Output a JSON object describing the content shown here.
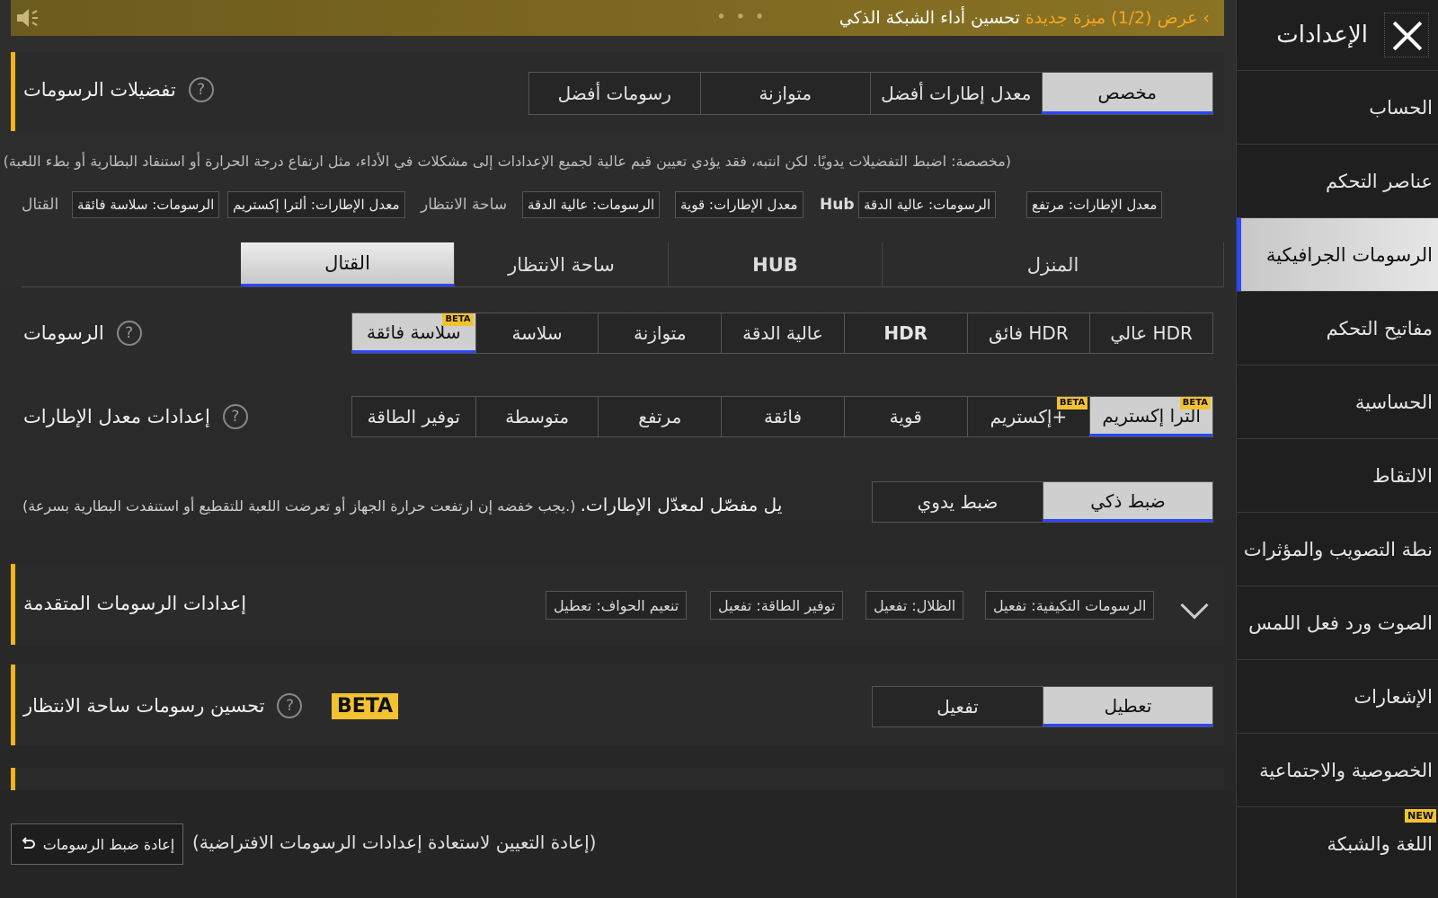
{
  "topbar": {
    "offer": "عرض (1/2)",
    "feature": "ميزة جديدة",
    "message": "تحسين أداء الشبكة الذكي"
  },
  "sidebar": {
    "title": "الإعدادات",
    "items": [
      {
        "label": "الحساب"
      },
      {
        "label": "عناصر التحكم"
      },
      {
        "label": "الرسومات الجرافيكية"
      },
      {
        "label": "مفاتيح التحكم"
      },
      {
        "label": "الحساسية"
      },
      {
        "label": "الالتقاط"
      },
      {
        "label": "نطة التصويب والمؤثرات"
      },
      {
        "label": "الصوت ورد فعل اللمس"
      },
      {
        "label": "الإشعارات"
      },
      {
        "label": "الخصوصية والاجتماعية"
      },
      {
        "label": "اللغة والشبكة",
        "badge": "NEW"
      }
    ]
  },
  "preferences": {
    "label": "تفضيلات الرسومات",
    "options": [
      "مخصص",
      "معدل إطارات أفضل",
      "متوازنة",
      "رسومات أفضل"
    ],
    "note": "(مخصصة: اضبط التفضيلات يدويًا. لكن انتبه، فقد يؤدي تعيين قيم عالية لجميع الإعدادات إلى مشكلات في الأداء، مثل ارتفاع درجة الحرارة أو استنفاد البطارية أو بطء اللعبة)",
    "summary": {
      "home_fps": "معدل الإطارات: مرتفع",
      "home_gfx": "الرسومات: عالية الدقة",
      "hub_label": "Hub",
      "hub_fps": "معدل الإطارات: قوية",
      "hub_gfx": "الرسومات: عالية الدقة",
      "lobby_label": "ساحة الانتظار",
      "combat_fps": "معدل الإطارات: ألترا إكستريم",
      "combat_gfx": "الرسومات: سلاسة فائقة",
      "combat_label": "القتال"
    }
  },
  "tabs": [
    "المنزل",
    "HUB",
    "ساحة الانتظار",
    "القتال"
  ],
  "graphics": {
    "label": "الرسومات",
    "options": [
      "عالي HDR",
      "فائق HDR",
      "HDR",
      "عالية الدقة",
      "متوازنة",
      "سلاسة",
      "سلاسة فائقة"
    ],
    "beta": "BETA"
  },
  "framerate": {
    "label": "إعدادات معدل الإطارات",
    "options": [
      "ألترا إكستريم",
      "إكستريم+",
      "قوية",
      "فائقة",
      "مرتفع",
      "متوسطة",
      "توفير الطاقة"
    ],
    "beta": "BETA"
  },
  "smart": {
    "options": [
      "ضبط ذكي",
      "ضبط يدوي"
    ],
    "title": ".يل مفصّل لمعدّل الإطارات",
    "note": "(يجب خفضه إن ارتفعت حرارة الجهاز أو تعرضت اللعبة للتقطيع أو استنفدت البطارية بسرعة.)"
  },
  "advanced": {
    "label": "إعدادات الرسومات المتقدمة",
    "tags": [
      "الرسومات التكيفية: تفعيل",
      "الظلال: تفعيل",
      "توفير الطاقة: تفعيل",
      "تنعيم الحواف: تعطيل"
    ]
  },
  "lobby_opt": {
    "label": "تحسين رسومات ساحة الانتظار",
    "beta": "BETA",
    "options": [
      "تعطيل",
      "تفعيل"
    ]
  },
  "footer": {
    "reset_button": "إعادة ضبط الرسومات",
    "reset_note": "(إعادة التعيين لاستعادة إعدادات الرسومات الافتراضية)"
  },
  "colors": {
    "accent": "#f2b31c",
    "selected_underline": "#2b47ff",
    "topbar": "#8a7324",
    "highlight_text": "#f5a524"
  }
}
